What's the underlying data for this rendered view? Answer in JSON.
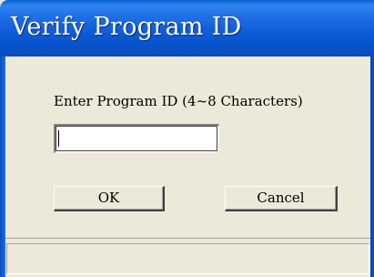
{
  "window": {
    "title": "Verify Program ID"
  },
  "form": {
    "prompt_label": "Enter Program ID (4~8 Characters)",
    "program_id_value": "",
    "program_id_placeholder": ""
  },
  "buttons": {
    "ok_label": "OK",
    "cancel_label": "Cancel"
  },
  "statusbar": {
    "text": ""
  },
  "colors": {
    "titlebar_blue": "#0c5ad6",
    "dialog_face": "#ece9d8"
  }
}
